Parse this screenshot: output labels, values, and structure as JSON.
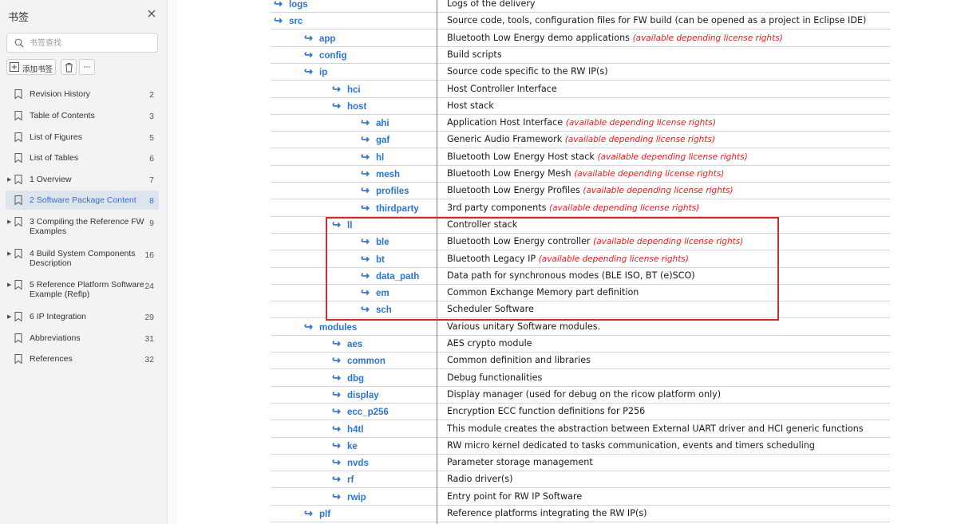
{
  "sidebar": {
    "title": "书签",
    "close_icon": "close-icon",
    "search": {
      "placeholder": "书签查找",
      "value": "",
      "icon": "search-icon"
    },
    "add_bookmark_label": "添加书签",
    "delete_icon": "trash-icon",
    "more_label": "···",
    "active_color": "#3a6fc4",
    "items": [
      {
        "label": "Revision History",
        "page": "2",
        "expandable": false,
        "active": false
      },
      {
        "label": "Table of Contents",
        "page": "3",
        "expandable": false,
        "active": false
      },
      {
        "label": "List of Figures",
        "page": "5",
        "expandable": false,
        "active": false
      },
      {
        "label": "List of Tables",
        "page": "6",
        "expandable": false,
        "active": false
      },
      {
        "label": "1 Overview",
        "page": "7",
        "expandable": true,
        "active": false
      },
      {
        "label": "2 Software Package Content",
        "page": "8",
        "expandable": false,
        "active": true
      },
      {
        "label": "3 Compiling the Reference FW Examples",
        "page": "9",
        "expandable": true,
        "active": false
      },
      {
        "label": "4 Build System Components Description",
        "page": "16",
        "expandable": true,
        "active": false
      },
      {
        "label": "5 Reference Platform Software Example (Reflp)",
        "page": "24",
        "expandable": true,
        "active": false
      },
      {
        "label": "6 IP Integration",
        "page": "29",
        "expandable": true,
        "active": false
      },
      {
        "label": "Abbreviations",
        "page": "31",
        "expandable": false,
        "active": false
      },
      {
        "label": "References",
        "page": "32",
        "expandable": false,
        "active": false
      }
    ]
  },
  "document": {
    "link_color": "#2e74c8",
    "note_color": "#e12020",
    "highlight_color": "#d42a2a",
    "rows": [
      {
        "dir": "logs",
        "level": 0,
        "desc": "Logs of the delivery",
        "note": ""
      },
      {
        "dir": "src",
        "level": 0,
        "desc": "Source code, tools, configuration files for FW build (can be opened as a project in Eclipse IDE)",
        "note": ""
      },
      {
        "dir": "app",
        "level": 1,
        "desc": "Bluetooth Low Energy demo applications ",
        "note": "(available depending license rights)"
      },
      {
        "dir": "config",
        "level": 1,
        "desc": "Build scripts",
        "note": ""
      },
      {
        "dir": "ip",
        "level": 1,
        "desc": "Source code specific to the RW IP(s)",
        "note": ""
      },
      {
        "dir": "hci",
        "level": 2,
        "desc": "Host Controller Interface",
        "note": ""
      },
      {
        "dir": "host",
        "level": 2,
        "desc": "Host stack",
        "note": ""
      },
      {
        "dir": "ahi",
        "level": 3,
        "desc": "Application Host Interface  ",
        "note": "(available depending license rights)"
      },
      {
        "dir": "gaf",
        "level": 3,
        "desc": "Generic Audio Framework ",
        "note": "(available depending license rights)"
      },
      {
        "dir": "hl",
        "level": 3,
        "desc": "Bluetooth Low Energy Host stack ",
        "note": "(available depending license rights)"
      },
      {
        "dir": "mesh",
        "level": 3,
        "desc": "Bluetooth Low Energy Mesh ",
        "note": "(available depending license rights)"
      },
      {
        "dir": "profiles",
        "level": 3,
        "desc": "Bluetooth Low Energy Profiles ",
        "note": "(available depending license rights)"
      },
      {
        "dir": "thirdparty",
        "level": 3,
        "desc": "3rd party components ",
        "note": "(available depending license rights)"
      },
      {
        "dir": "ll",
        "level": 2,
        "desc": "Controller stack",
        "note": ""
      },
      {
        "dir": "ble",
        "level": 3,
        "desc": "Bluetooth Low Energy controller ",
        "note": "(available depending license rights)"
      },
      {
        "dir": "bt",
        "level": 3,
        "desc": "Bluetooth Legacy IP ",
        "note": "(available depending license rights)"
      },
      {
        "dir": "data_path",
        "level": 3,
        "desc": "Data path for synchronous modes (BLE ISO, BT (e)SCO)",
        "note": ""
      },
      {
        "dir": "em",
        "level": 3,
        "desc": "Common Exchange Memory part definition",
        "note": ""
      },
      {
        "dir": "sch",
        "level": 3,
        "desc": "Scheduler Software",
        "note": ""
      },
      {
        "dir": "modules",
        "level": 1,
        "desc": "Various unitary Software modules.",
        "note": ""
      },
      {
        "dir": "aes",
        "level": 2,
        "desc": "AES crypto module",
        "note": ""
      },
      {
        "dir": "common",
        "level": 2,
        "desc": "Common definition and libraries",
        "note": ""
      },
      {
        "dir": "dbg",
        "level": 2,
        "desc": "Debug functionalities",
        "note": ""
      },
      {
        "dir": "display",
        "level": 2,
        "desc": "Display manager (used for debug on the ricow platform only)",
        "note": ""
      },
      {
        "dir": "ecc_p256",
        "level": 2,
        "desc": "Encryption  ECC function definitions for P256",
        "note": ""
      },
      {
        "dir": "h4tl",
        "level": 2,
        "desc": "This module creates the abstraction between External UART driver and HCI generic functions",
        "note": ""
      },
      {
        "dir": "ke",
        "level": 2,
        "desc": "RW micro kernel dedicated to tasks communication, events and timers scheduling",
        "note": ""
      },
      {
        "dir": "nvds",
        "level": 2,
        "desc": "Parameter storage management",
        "note": ""
      },
      {
        "dir": "rf",
        "level": 2,
        "desc": "Radio driver(s)",
        "note": ""
      },
      {
        "dir": "rwip",
        "level": 2,
        "desc": "Entry point for RW IP Software",
        "note": ""
      },
      {
        "dir": "plf",
        "level": 1,
        "desc": "Reference platforms integrating the RW IP(s)",
        "note": ""
      }
    ]
  }
}
